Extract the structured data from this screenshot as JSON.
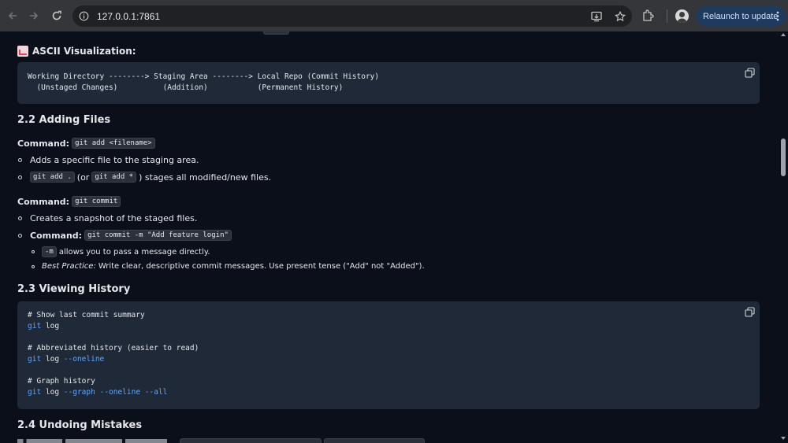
{
  "browser": {
    "url": "127.0.0.1:7861",
    "relaunch_label": "Relaunch to update"
  },
  "sections": {
    "ascii": {
      "heading": "ASCII Visualization:",
      "code_line1": "Working Directory --------> Staging Area --------> Local Repo (Commit History)",
      "code_line2": "  (Unstaged Changes)          (Addition)           (Permanent History)"
    },
    "adding": {
      "heading": "2.2 Adding Files",
      "cmd1_label": "Command:",
      "cmd1_code": "git add <filename>",
      "cmd1_bullet1": "Adds a specific file to the staging area.",
      "cmd1_bullet2_code_a": "git add .",
      "cmd1_bullet2_mid": "(or",
      "cmd1_bullet2_code_b": "git add *",
      "cmd1_bullet2_tail": ") stages all modified/new files.",
      "cmd2_label": "Command:",
      "cmd2_code": "git commit",
      "cmd2_bullet1": "Creates a snapshot of the staged files.",
      "cmd2_bullet2_label": "Command:",
      "cmd2_bullet2_code": "git commit -m \"Add feature login\"",
      "sub1_code": "-m",
      "sub1_text": "allows you to pass a message directly.",
      "sub2_label": "Best Practice:",
      "sub2_text": "Write clear, descriptive commit messages. Use present tense (\"Add\" not \"Added\")."
    },
    "history": {
      "heading": "2.3 Viewing History",
      "c1": "# Show last commit summary",
      "l1_cmd": "git",
      "l1_rest": " log",
      "c2": "# Abbreviated history (easier to read)",
      "l2_cmd": "git",
      "l2_mid": " log ",
      "l2_flag": "--oneline",
      "c3": "# Graph history",
      "l3_cmd": "git",
      "l3_mid": " log ",
      "l3_flag1": "--graph",
      "l3_flag2": "--oneline",
      "l3_flag3": "--all"
    },
    "undo": {
      "heading": "2.4 Undoing Mistakes"
    }
  },
  "icons": [
    "back-arrow-icon",
    "forward-arrow-icon",
    "reload-icon",
    "site-info-icon",
    "install-app-icon",
    "bookmark-star-icon",
    "extensions-icon",
    "profile-avatar",
    "menu-dots-icon",
    "copy-icon"
  ]
}
